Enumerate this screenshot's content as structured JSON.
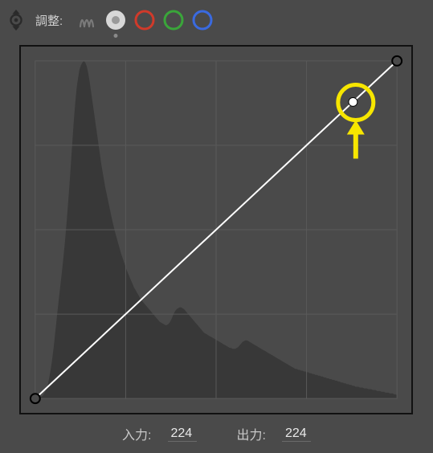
{
  "toolbar": {
    "adjust_label": "調整:",
    "channels": {
      "combined": "combined",
      "red": "red",
      "green": "green",
      "blue": "blue",
      "active": "combined"
    }
  },
  "readout": {
    "input_label": "入力:",
    "input_value": "224",
    "output_label": "出力:",
    "output_value": "224"
  },
  "colors": {
    "panel_bg": "#4a4a4a",
    "frame_border": "#111111",
    "grid": "#5a5a5a",
    "histogram": "#383838",
    "curve_line": "#ffffff",
    "channel_red": "#d03a2a",
    "channel_green": "#3aa53a",
    "channel_blue": "#3a6ae0",
    "annotation": "#f7e600"
  },
  "chart_data": {
    "type": "line",
    "title": "",
    "xlabel": "入力",
    "ylabel": "出力",
    "xlim": [
      0,
      255
    ],
    "ylim": [
      0,
      255
    ],
    "grid": true,
    "series": [
      {
        "name": "curve",
        "x": [
          0,
          224,
          255
        ],
        "y": [
          0,
          224,
          255
        ]
      }
    ],
    "selected_point": {
      "x": 224,
      "y": 224
    },
    "histogram": [
      0,
      0,
      0,
      1,
      2,
      3,
      5,
      8,
      12,
      18,
      26,
      36,
      48,
      62,
      78,
      94,
      110,
      125,
      140,
      155,
      172,
      190,
      210,
      232,
      255,
      280,
      305,
      330,
      350,
      368,
      380,
      390,
      395,
      398,
      400,
      398,
      394,
      386,
      376,
      364,
      352,
      340,
      328,
      316,
      304,
      292,
      280,
      270,
      260,
      250,
      242,
      234,
      226,
      218,
      210,
      203,
      196,
      190,
      184,
      178,
      172,
      167,
      162,
      157,
      152,
      148,
      144,
      140,
      136,
      132,
      129,
      126,
      123,
      120,
      117,
      115,
      113,
      111,
      109,
      107,
      105,
      103,
      101,
      99,
      97,
      95,
      93,
      91,
      90,
      89,
      88,
      87,
      87,
      88,
      90,
      93,
      97,
      101,
      104,
      106,
      107,
      108,
      108,
      107,
      106,
      104,
      102,
      100,
      98,
      96,
      94,
      92,
      90,
      88,
      86,
      84,
      82,
      80,
      78,
      77,
      76,
      75,
      74,
      73,
      72,
      71,
      70,
      69,
      68,
      67,
      66,
      65,
      64,
      63,
      62,
      61,
      60,
      60,
      59,
      59,
      59,
      60,
      61,
      63,
      65,
      67,
      68,
      69,
      69,
      68,
      67,
      66,
      65,
      64,
      63,
      62,
      61,
      60,
      59,
      58,
      57,
      56,
      55,
      54,
      53,
      52,
      51,
      50,
      49,
      48,
      47,
      46,
      45,
      44,
      43,
      42,
      41,
      40,
      39,
      38,
      37,
      36,
      35,
      35,
      34,
      34,
      33,
      33,
      32,
      32,
      31,
      31,
      30,
      30,
      29,
      29,
      28,
      28,
      27,
      27,
      26,
      26,
      25,
      25,
      24,
      24,
      23,
      23,
      22,
      22,
      21,
      21,
      20,
      20,
      19,
      19,
      18,
      18,
      17,
      17,
      16,
      16,
      15,
      15,
      14,
      14,
      14,
      13,
      13,
      13,
      12,
      12,
      12,
      11,
      11,
      11,
      10,
      10,
      10,
      9,
      9,
      9,
      8,
      8,
      8,
      7,
      7,
      7,
      6,
      6,
      6,
      5,
      5,
      4
    ]
  }
}
